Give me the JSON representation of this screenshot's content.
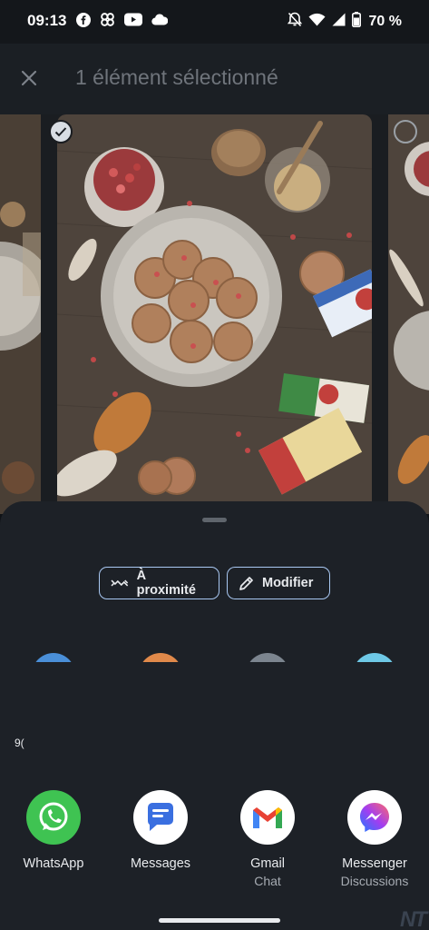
{
  "status_bar": {
    "time": "09:13",
    "battery": "70 %",
    "left_icons": [
      "facebook-icon",
      "pinwheel-icon",
      "youtube-icon",
      "cloud-icon"
    ],
    "right_icons": [
      "do-not-disturb-icon",
      "wifi-icon",
      "signal-icon",
      "battery-icon"
    ]
  },
  "top_bar": {
    "title": "1 élément sélectionné",
    "close_icon": "close-icon"
  },
  "photos": {
    "selected_index": 1,
    "count_visible": 3
  },
  "share_sheet": {
    "chips": [
      {
        "label": "À proximité",
        "icon": "nearby-share-icon"
      },
      {
        "label": "Modifier",
        "icon": "pencil-icon"
      }
    ],
    "contact_colors": [
      "#4a8fd8",
      "#e0894a",
      "#7c858f",
      "#6ec8e6"
    ],
    "truncated_label": "9(",
    "apps": [
      {
        "label": "WhatsApp",
        "sub": "",
        "icon": "whatsapp-icon",
        "color": "#3fc352"
      },
      {
        "label": "Messages",
        "sub": "",
        "icon": "messages-icon",
        "color": "#ffffff"
      },
      {
        "label": "Gmail",
        "sub": "Chat",
        "icon": "gmail-icon",
        "color": "#ffffff"
      },
      {
        "label": "Messenger",
        "sub": "Discussions",
        "icon": "messenger-icon",
        "color": "#ffffff"
      }
    ],
    "watermark": "NT"
  }
}
